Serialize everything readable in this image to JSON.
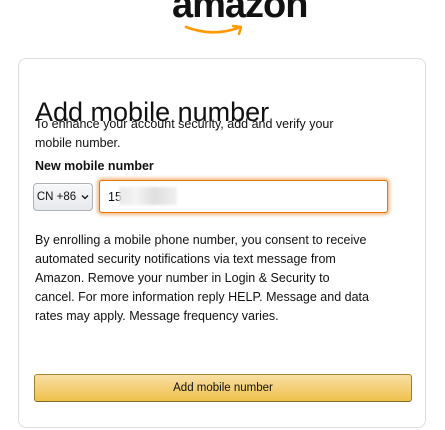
{
  "brand": {
    "logo_text": "amazon",
    "logo_color": "#111111",
    "smile_color": "#ff9900"
  },
  "form": {
    "title": "Add mobile number",
    "intro": "To enhance your account security, add and verify your mobile number.",
    "field_label": "New mobile number",
    "country_code": "CN +86",
    "phone_value": "15",
    "disclaimer": "By enrolling a mobile phone number, you consent to receive automated security notifications via text message from Amazon. Remove your number in Login & Security to cancel. For more information reply HELP. Message and data rates may apply. Message frequency varies.",
    "submit_label": "Add mobile number"
  },
  "colors": {
    "button_top": "#f7dfa5",
    "button_bottom": "#f0c14b",
    "focus_border": "#e77600"
  }
}
